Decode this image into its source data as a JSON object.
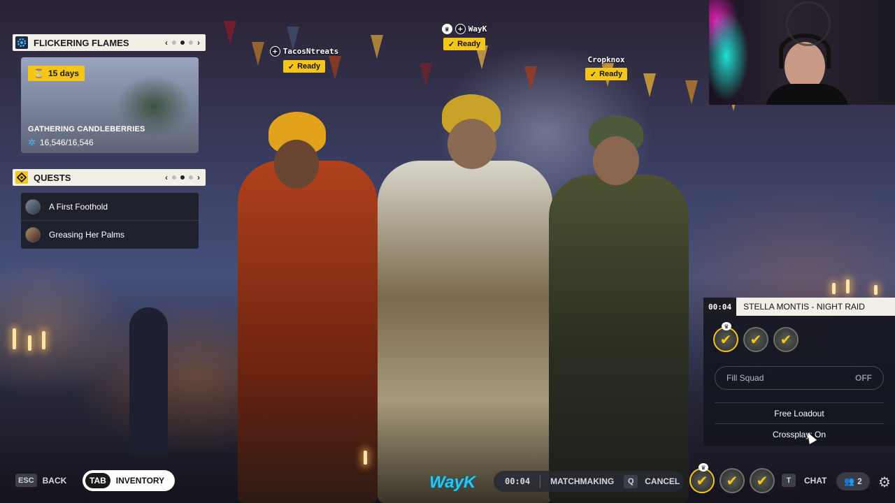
{
  "event": {
    "title": "FLICKERING FLAMES",
    "badge_days": "15 days",
    "card_title": "GATHERING CANDLEBERRIES",
    "progress": "16,546/16,546",
    "pager_count": 3,
    "pager_active": 1
  },
  "quests": {
    "title": "QUESTS",
    "items": [
      {
        "label": "A First Foothold"
      },
      {
        "label": "Greasing Her Palms"
      }
    ]
  },
  "players": [
    {
      "name": "TacosNtreats",
      "status": "Ready",
      "icon": "plus-circle-icon"
    },
    {
      "name": "WayK",
      "status": "Ready",
      "icon": "crown-icon"
    },
    {
      "name": "Cropknox",
      "status": "Ready",
      "icon": ""
    }
  ],
  "squad": {
    "timer": "00:04",
    "mission": "STELLA MONTIS - NIGHT RAID",
    "fill_squad_label": "Fill Squad",
    "fill_squad_value": "OFF",
    "options": [
      "Free Loadout",
      "Crossplay: On"
    ]
  },
  "bottom": {
    "back_key": "ESC",
    "back_label": "BACK",
    "inventory_key": "TAB",
    "inventory_label": "INVENTORY",
    "streamer": "WayK",
    "mm_timer": "00:04",
    "mm_label": "MATCHMAKING",
    "cancel_key": "Q",
    "cancel_label": "CANCEL",
    "chat_key": "T",
    "chat_label": "CHAT",
    "friends_count": "2"
  },
  "colors": {
    "accent": "#f5c518",
    "panel": "#f2efe6",
    "streamer": "#29c6f0"
  }
}
